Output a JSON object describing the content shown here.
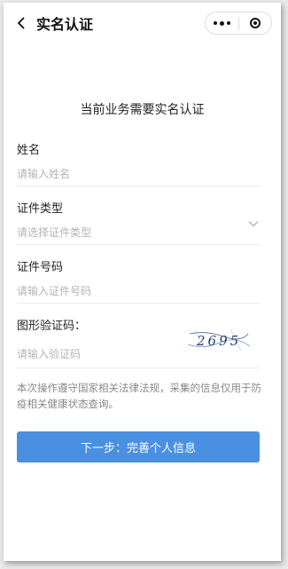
{
  "nav": {
    "title": "实名认证",
    "icons": {
      "back": "back-arrow-icon",
      "more": "more-dots-icon",
      "close": "target-close-icon"
    }
  },
  "heading": "当前业务需要实名认证",
  "fields": {
    "name": {
      "label": "姓名",
      "placeholder": "请输入姓名"
    },
    "id_type": {
      "label": "证件类型",
      "placeholder": "请选择证件类型"
    },
    "id_number": {
      "label": "证件号码",
      "placeholder": "请输入证件号码"
    },
    "captcha": {
      "label": "图形验证码：",
      "placeholder": "请输入验证码",
      "image_text": "2695"
    }
  },
  "notice": "本次操作遵守国家相关法律法规，采集的信息仅用于防疫相关健康状态查询。",
  "button": {
    "label": "下一步：完善个人信息"
  },
  "colors": {
    "primary": "#4a90e2",
    "placeholder": "#b4b4b4",
    "divider": "#ececec"
  }
}
